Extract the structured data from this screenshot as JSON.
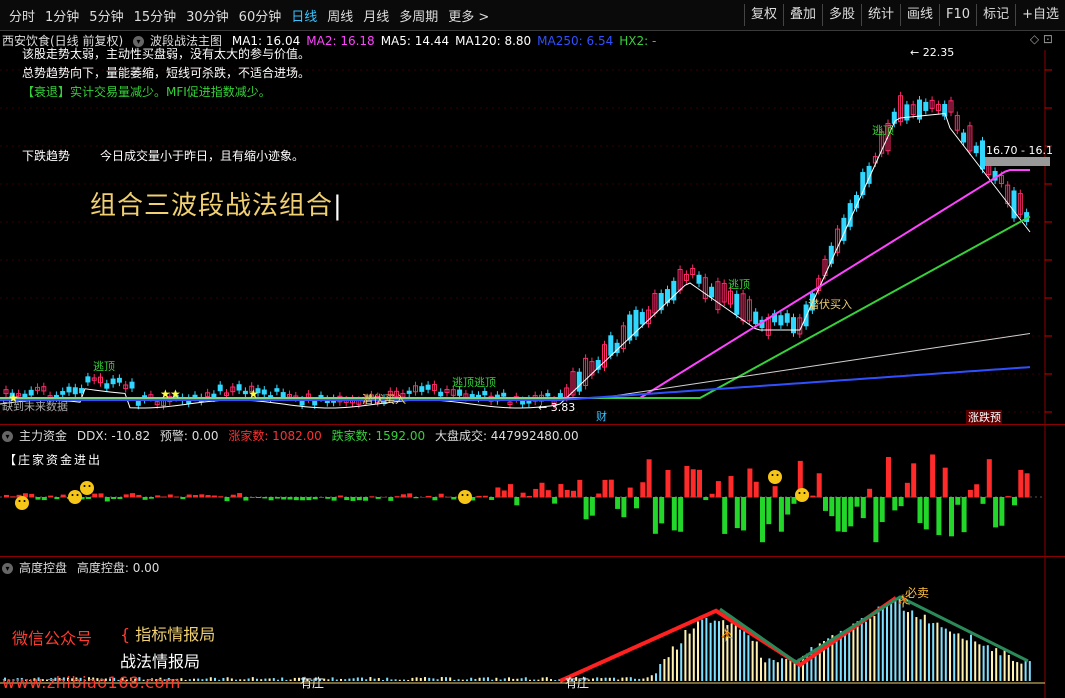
{
  "toolbar": {
    "periods": [
      "分时",
      "1分钟",
      "5分钟",
      "15分钟",
      "30分钟",
      "60分钟",
      "日线",
      "周线",
      "月线",
      "多周期",
      "更多 >"
    ],
    "active_period": "日线",
    "right_buttons": [
      "复权",
      "叠加",
      "多股",
      "统计",
      "画线",
      "F10",
      "标记",
      "+自选"
    ]
  },
  "main": {
    "stock_title": "西安饮食(日线 前复权)",
    "indicator": "波段战法主图",
    "legend": [
      {
        "label": "MA1: 16.04",
        "color": "#ffffff"
      },
      {
        "label": "MA2: 16.18",
        "color": "#ff44ff"
      },
      {
        "label": "MA5: 14.44",
        "color": "#ffffff"
      },
      {
        "label": "MA120: 8.80",
        "color": "#ffffff"
      },
      {
        "label": "MA250: 6.54",
        "color": "#3050ff"
      },
      {
        "label": "HX2: -",
        "color": "#36d13a"
      }
    ],
    "notes": [
      "该股走势太弱，主动性买盘弱，没有太大的参与价值。",
      "总势趋势向下，量能萎缩，短线可杀跌，不适合进场。",
      "【衰退】实计交易量减少。MFI促进指数减少。"
    ],
    "trend_label": "下跌趋势",
    "trend_note": "今日成交量小于昨日，且有缩小迹象。",
    "big_title": "组合三波段战法组合",
    "max_price": "22.35",
    "min_price": "3.83",
    "price_band": "16.70 - 16.1",
    "signals": {
      "escape_top": "逃顶",
      "bottom_buy": "潜伏买入",
      "no_future": "缺到未来数据",
      "cai": "财",
      "limit_up": "涨跌预"
    }
  },
  "capital": {
    "title": "主力资金",
    "ddx": "DDX: -10.82",
    "alert": "预警: 0.00",
    "up_count": "涨家数: 1082.00",
    "down_count": "跌家数: 1592.00",
    "market_vol": "大盘成交: 447992480.00",
    "sub_label": "【庄家资金进出"
  },
  "control": {
    "title": "高度控盘",
    "value": "高度控盘: 0.00",
    "sell_signal": "必卖",
    "you_zhuang": "有庄",
    "wechat_label": "微信公众号",
    "brand1": "指标情报局",
    "brand2": "战法情报局",
    "url": "www.zhibiao168.com"
  },
  "colors": {
    "up": "#ff2a2a",
    "down": "#23d62a",
    "accent_cyan": "#39c3ff",
    "magenta": "#ff44ff",
    "gold": "#f0d070"
  }
}
